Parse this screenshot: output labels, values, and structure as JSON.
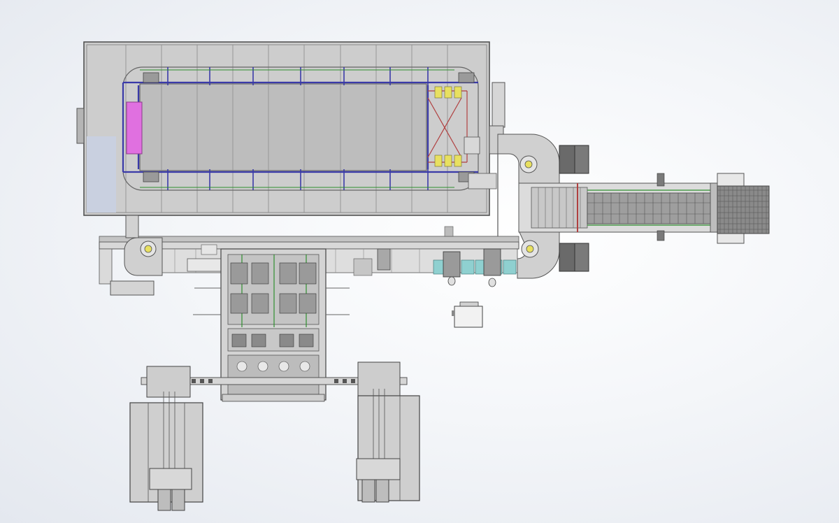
{
  "drawing": {
    "view": "top",
    "colors": {
      "background": "#eef1f6",
      "frame_fill": "#c9c9c9",
      "frame_stroke": "#4a4a4a",
      "panel_fill": "#bcbcbc",
      "conveyor_blue": "#3a3aa8",
      "chain_green": "#2f8f2f",
      "chain_red": "#b04040",
      "magenta_plate": "#e070e0",
      "yellow_parts": "#e8e060",
      "teal_parts": "#8fd0d0",
      "dark_metal": "#5a5a5a",
      "grid_dark": "#707070"
    }
  }
}
